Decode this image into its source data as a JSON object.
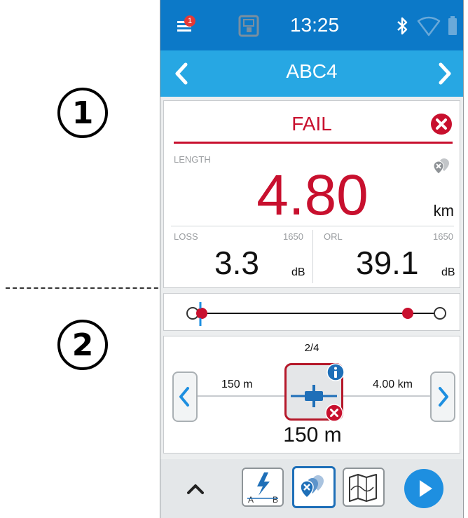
{
  "callouts": {
    "first": "1",
    "second": "2"
  },
  "status_bar": {
    "time": "13:25",
    "notification_count": "1",
    "icons": [
      "menu-icon",
      "save-file-icon",
      "bluetooth-icon",
      "wifi-icon",
      "battery-icon"
    ]
  },
  "nav": {
    "title": "ABC4"
  },
  "result": {
    "status": "FAIL",
    "length_label": "LENGTH",
    "length_value": "4.80",
    "length_unit": "km",
    "loss_label": "LOSS",
    "loss_wavelength": "1650",
    "loss_value": "3.3",
    "loss_unit": "dB",
    "orl_label": "ORL",
    "orl_wavelength": "1650",
    "orl_value": "39.1",
    "orl_unit": "dB"
  },
  "event_nav": {
    "counter": "2/4",
    "distance_before": "150 m",
    "distance_after": "4.00 km",
    "event_distance": "150 m"
  },
  "colors": {
    "fail_red": "#c8102e",
    "status_blue": "#0c79c8",
    "nav_blue": "#27a7e3",
    "accent_blue": "#1e8fe0"
  }
}
